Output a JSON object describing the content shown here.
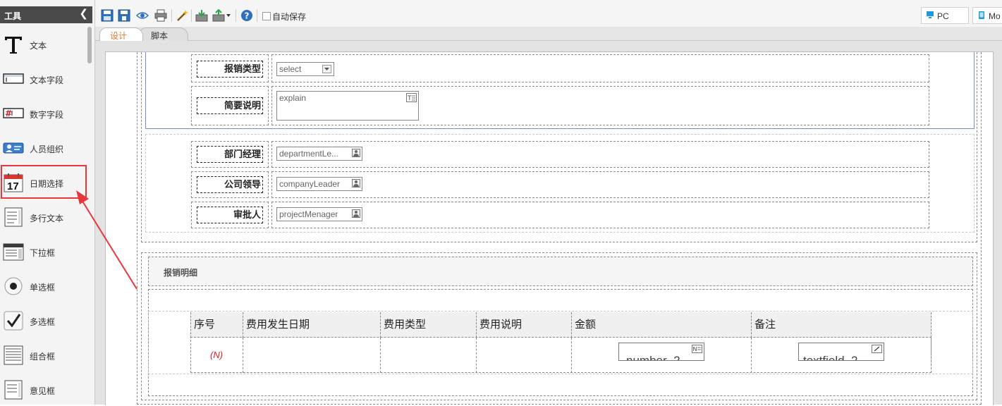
{
  "sidebar": {
    "title": "工具",
    "collapse_glyph": "❮",
    "tools": [
      {
        "label": "文本",
        "icon": "text-icon"
      },
      {
        "label": "文本字段",
        "icon": "textfield-icon"
      },
      {
        "label": "数字字段",
        "icon": "numberfield-icon"
      },
      {
        "label": "人员组织",
        "icon": "org-icon"
      },
      {
        "label": "日期选择",
        "icon": "calendar-icon",
        "icon_text": "17"
      },
      {
        "label": "多行文本",
        "icon": "multiline-icon"
      },
      {
        "label": "下拉框",
        "icon": "dropdown-icon"
      },
      {
        "label": "单选框",
        "icon": "radio-icon"
      },
      {
        "label": "多选框",
        "icon": "checkbox-icon"
      },
      {
        "label": "组合框",
        "icon": "combobox-icon"
      },
      {
        "label": "意见框",
        "icon": "opinion-icon"
      }
    ]
  },
  "toolbar": {
    "autosave_label": "自动保存",
    "devices": [
      {
        "label": "PC",
        "icon": "monitor-icon"
      },
      {
        "label": "Mo",
        "icon": "mobile-icon"
      }
    ]
  },
  "tabs": [
    {
      "label": "设计",
      "active": true
    },
    {
      "label": "脚本",
      "active": false
    }
  ],
  "form": {
    "fields": [
      {
        "label": "报销类型",
        "value": "select",
        "kind": "select"
      },
      {
        "label": "简要说明",
        "value": "explain",
        "kind": "textarea"
      },
      {
        "label": "部门经理",
        "value": "departmentLe...",
        "kind": "person"
      },
      {
        "label": "公司领导",
        "value": "companyLeader",
        "kind": "person"
      },
      {
        "label": "审批人",
        "value": "projectMenager",
        "kind": "person"
      }
    ],
    "section_title": "报销明细",
    "table": {
      "headers": [
        "序号",
        "费用发生日期",
        "费用类型",
        "费用说明",
        "金额",
        "备注"
      ],
      "row": {
        "seq": "(N)",
        "amount": "number_2",
        "remark": "textfield_2"
      }
    }
  },
  "colors": {
    "accent_blue": "#2f6fc0",
    "highlight_red": "#e8363a",
    "seq_red": "#d0202a"
  }
}
